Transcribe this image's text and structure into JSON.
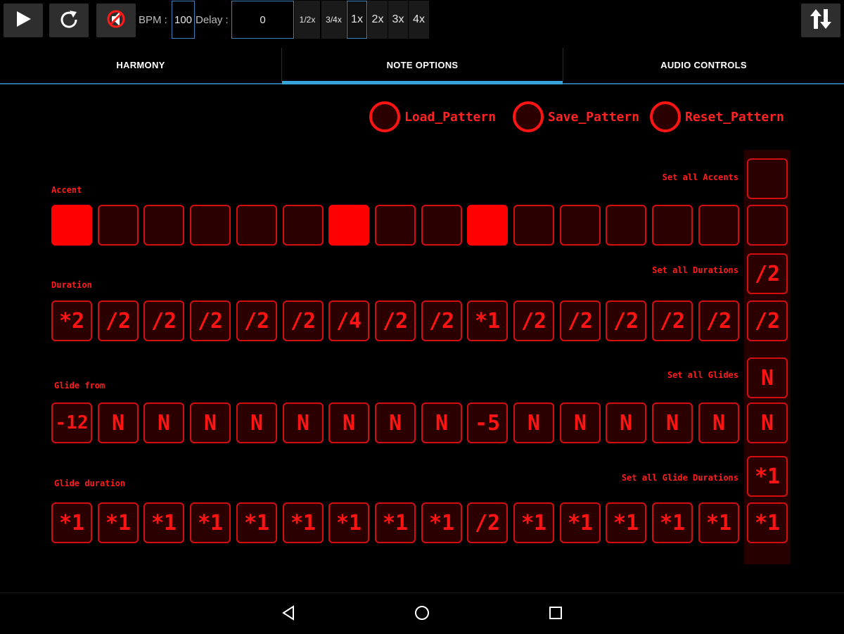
{
  "toolbar": {
    "bpm_label": "BPM :",
    "bpm_value": "100",
    "delay_label": "Delay :",
    "delay_value": "0",
    "speeds": [
      {
        "label": "1/2x",
        "active": false
      },
      {
        "label": "3/4x",
        "active": false
      },
      {
        "label": "1x",
        "active": true
      },
      {
        "label": "2x",
        "active": false
      },
      {
        "label": "3x",
        "active": false
      },
      {
        "label": "4x",
        "active": false
      }
    ],
    "icons": [
      "play-icon",
      "refresh-icon",
      "mute-icon",
      "swap-icon"
    ]
  },
  "tabs": [
    {
      "label": "HARMONY",
      "selected": false
    },
    {
      "label": "NOTE OPTIONS",
      "selected": true
    },
    {
      "label": "AUDIO CONTROLS",
      "selected": false
    }
  ],
  "pattern_actions": {
    "load": "Load_Pattern",
    "save": "Save_Pattern",
    "reset": "Reset_Pattern"
  },
  "rows": {
    "accent": {
      "label": "Accent",
      "set_all_label": "Set all Accents",
      "set_all_value": "",
      "all_value": "",
      "steps_on": [
        true,
        false,
        false,
        false,
        false,
        false,
        true,
        false,
        false,
        true,
        false,
        false,
        false,
        false,
        false
      ]
    },
    "duration": {
      "label": "Duration",
      "set_all_label": "Set all Durations",
      "set_all_value": "/2",
      "all_value": "/2",
      "steps": [
        "*2",
        "/2",
        "/2",
        "/2",
        "/2",
        "/2",
        "/4",
        "/2",
        "/2",
        "*1",
        "/2",
        "/2",
        "/2",
        "/2",
        "/2"
      ]
    },
    "glide_from": {
      "label": "Glide from",
      "set_all_label": "Set all Glides",
      "set_all_value": "N",
      "all_value": "N",
      "steps": [
        "-12",
        "N",
        "N",
        "N",
        "N",
        "N",
        "N",
        "N",
        "N",
        "-5",
        "N",
        "N",
        "N",
        "N",
        "N"
      ]
    },
    "glide_duration": {
      "label": "Glide duration",
      "set_all_label": "Set all Glide Durations",
      "set_all_value": "*1",
      "all_value": "*1",
      "steps": [
        "*1",
        "*1",
        "*1",
        "*1",
        "*1",
        "*1",
        "*1",
        "*1",
        "*1",
        "/2",
        "*1",
        "*1",
        "*1",
        "*1",
        "*1"
      ]
    }
  },
  "colors": {
    "accent_red": "#ff1414",
    "cell_fill": "#2a0000",
    "tab_indicator": "#36a3d9"
  }
}
